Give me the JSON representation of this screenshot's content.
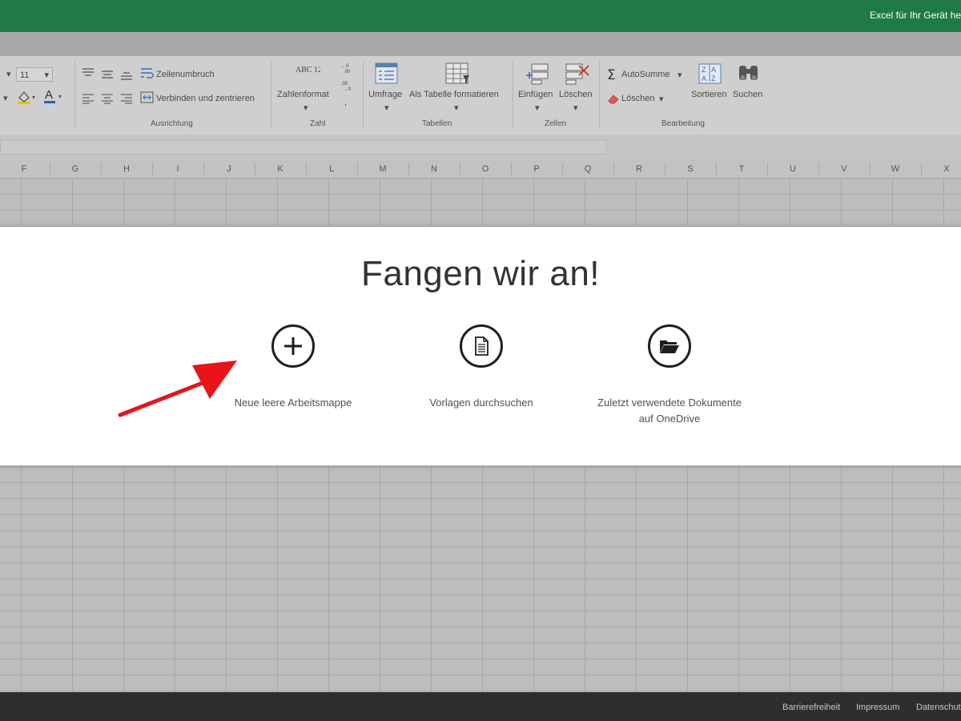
{
  "topbar": {
    "promo": "Excel für Ihr Gerät he"
  },
  "ribbon": {
    "font_size": "11",
    "wrap_text": "Zeilenumbruch",
    "merge_center": "Verbinden und zentrieren",
    "group_alignment": "Ausrichtung",
    "number_format_icon": "ABC 123",
    "number_format": "Zahlenformat",
    "group_number": "Zahl",
    "survey": "Umfrage",
    "format_as_table": "Als Tabelle formatieren",
    "group_tables": "Tabellen",
    "insert": "Einfügen",
    "delete": "Löschen",
    "group_cells": "Zellen",
    "autosum": "AutoSumme",
    "clear": "Löschen",
    "sort": "Sortieren",
    "find": "Suchen",
    "group_editing": "Bearbeitung"
  },
  "columns": [
    "F",
    "G",
    "H",
    "I",
    "J",
    "K",
    "L",
    "M",
    "N",
    "O",
    "P",
    "Q",
    "R",
    "S",
    "T",
    "U",
    "V",
    "W",
    "X"
  ],
  "dialog": {
    "title": "Fangen wir an!",
    "options": [
      {
        "label": "Neue leere Arbeitsmappe",
        "icon": "plus-circle-icon"
      },
      {
        "label": "Vorlagen durchsuchen",
        "icon": "document-icon"
      },
      {
        "label": "Zuletzt verwendete Dokumente",
        "label2": "auf OneDrive",
        "icon": "open-folder-icon"
      }
    ]
  },
  "footer": {
    "links": [
      "Barrierefreiheit",
      "Impressum",
      "Datenschut"
    ]
  },
  "colors": {
    "excel_green": "#1f7a45",
    "arrow_red": "#e8141a"
  }
}
